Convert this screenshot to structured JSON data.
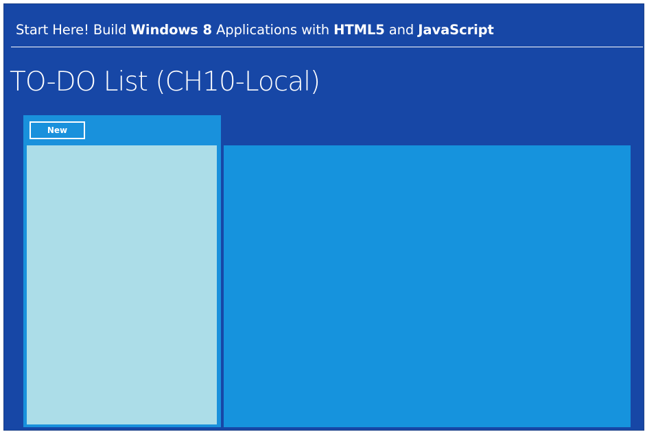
{
  "header": {
    "banner_parts": [
      {
        "text": "Start Here! Build ",
        "bold": false
      },
      {
        "text": "Windows 8",
        "bold": true
      },
      {
        "text": " Applications with ",
        "bold": false
      },
      {
        "text": "HTML5",
        "bold": true
      },
      {
        "text": " and ",
        "bold": false
      },
      {
        "text": "JavaScript",
        "bold": true
      }
    ]
  },
  "page": {
    "title": "TO-DO List (CH10-Local)"
  },
  "list_panel": {
    "new_button_label": "New",
    "items": []
  },
  "colors": {
    "background": "#1747a6",
    "list_panel": "#1991dc",
    "list_view": "#acdde8",
    "detail_panel": "#1693dd",
    "text": "#ffffff"
  }
}
